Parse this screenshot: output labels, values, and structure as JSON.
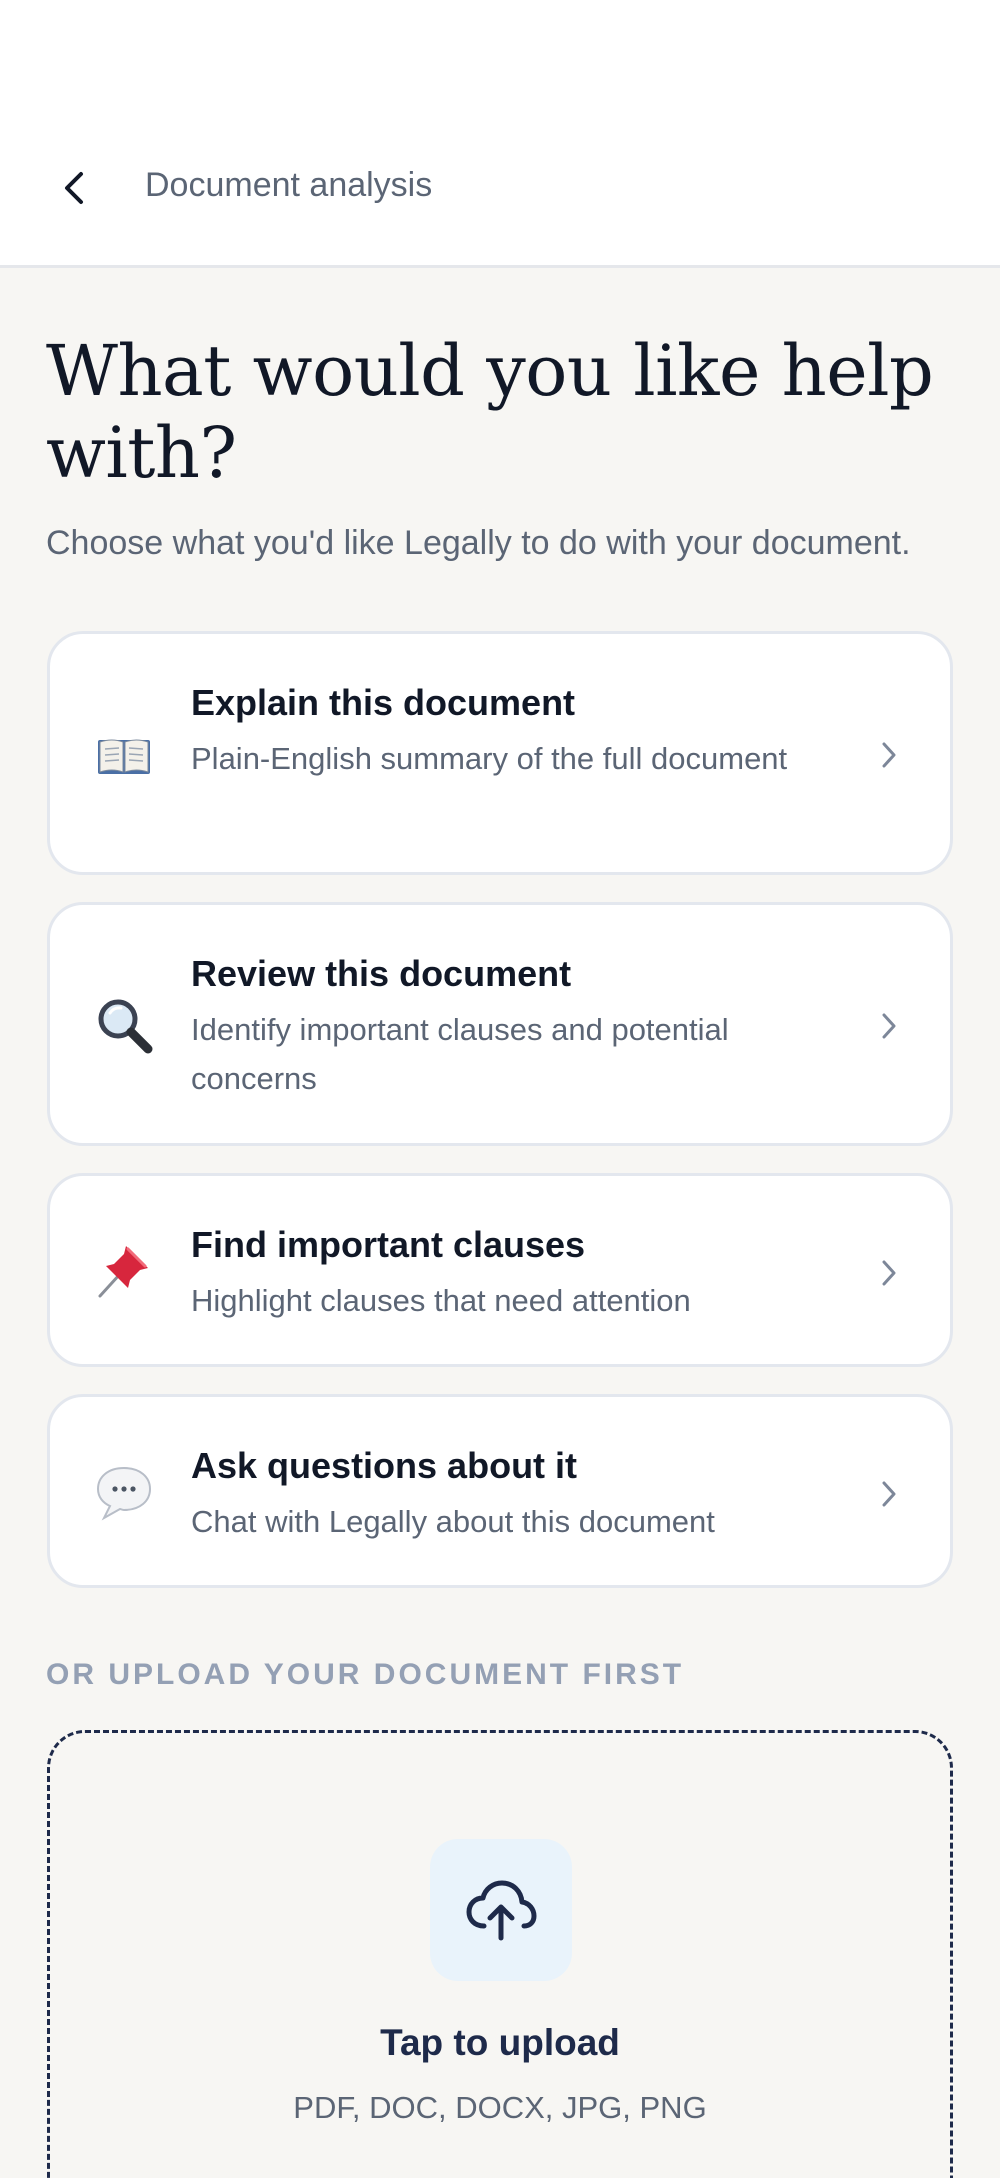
{
  "header": {
    "title": "Document analysis",
    "back_icon": "chevron-left-icon"
  },
  "page": {
    "title": "What would you like help with?",
    "subtitle": "Choose what you'd like Legally to do with your document."
  },
  "options": [
    {
      "icon": "open-book-icon",
      "title": "Explain this document",
      "description": "Plain-English summary of the full document"
    },
    {
      "icon": "magnifying-glass-icon",
      "title": "Review this document",
      "description": "Identify important clauses and potential concerns"
    },
    {
      "icon": "pushpin-icon",
      "title": "Find important clauses",
      "description": "Highlight clauses that need attention"
    },
    {
      "icon": "speech-bubble-icon",
      "title": "Ask questions about it",
      "description": "Chat with Legally about this document"
    }
  ],
  "upload": {
    "section_label": "OR UPLOAD YOUR DOCUMENT FIRST",
    "icon": "cloud-upload-icon",
    "title": "Tap to upload",
    "formats": "PDF, DOC, DOCX, JPG, PNG"
  },
  "colors": {
    "background": "#f7f6f3",
    "card_border": "#e3e7ee",
    "heading": "#111827",
    "muted_text": "#5b6575",
    "section_label": "#94a0b4",
    "navy": "#1e2a4a",
    "upload_icon_bg": "#e9f3fb"
  }
}
